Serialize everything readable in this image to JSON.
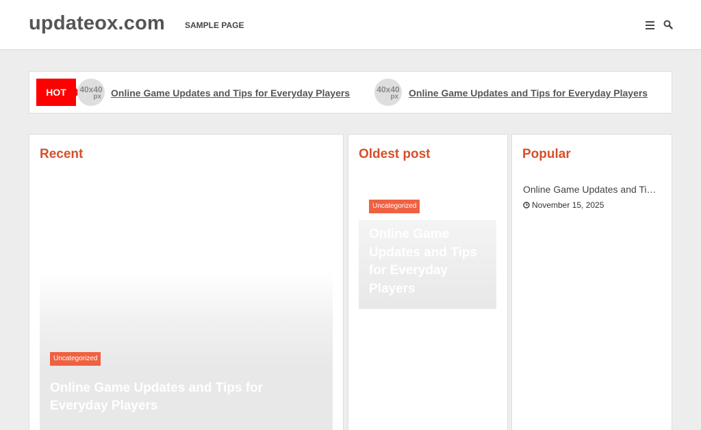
{
  "header": {
    "site_title": "updateox.com",
    "nav": {
      "sample_page": "SAMPLE PAGE"
    },
    "icons": [
      "menu-icon",
      "search-icon"
    ]
  },
  "ticker": {
    "badge": "HOT",
    "items": [
      {
        "thumb_text": "40x40",
        "thumb_unit": "px",
        "title": "Online Game Updates and Tips for Everyday Players"
      },
      {
        "thumb_text": "40x40",
        "thumb_unit": "px",
        "title": "Online Game Updates and Tips for Everyday Players"
      }
    ]
  },
  "recent": {
    "heading": "Recent",
    "post": {
      "category": "Uncategorized",
      "title": "Online Game Updates and Tips for Everyday Players"
    }
  },
  "oldest": {
    "heading": "Oldest post",
    "post": {
      "category": "Uncategorized",
      "title": "Online Game Updates and Tips for Everyday Players"
    }
  },
  "popular": {
    "heading": "Popular",
    "post": {
      "title": "Online Game Updates and Tips for Everyday Players",
      "date": "November 15, 2025"
    }
  },
  "colors": {
    "accent": "#d64f2a",
    "hot": "#ff0000",
    "badge": "#ef6141"
  }
}
